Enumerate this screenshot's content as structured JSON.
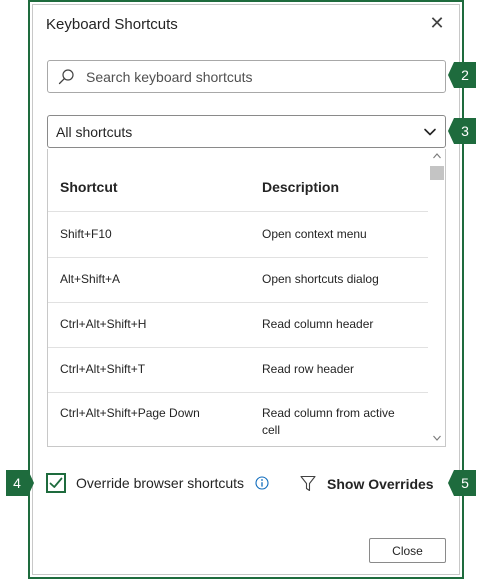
{
  "dialog": {
    "title": "Keyboard Shortcuts",
    "close_icon": "close-icon"
  },
  "search": {
    "placeholder": "Search keyboard shortcuts",
    "value": "",
    "icon": "search-icon"
  },
  "filter_dropdown": {
    "selected": "All shortcuts",
    "icon": "chevron-down-icon"
  },
  "table": {
    "headers": {
      "shortcut": "Shortcut",
      "description": "Description"
    },
    "rows": [
      {
        "shortcut": "Shift+F10",
        "description": "Open context menu"
      },
      {
        "shortcut": "Alt+Shift+A",
        "description": "Open shortcuts dialog"
      },
      {
        "shortcut": "Ctrl+Alt+Shift+H",
        "description": "Read column header"
      },
      {
        "shortcut": "Ctrl+Alt+Shift+T",
        "description": "Read row header"
      },
      {
        "shortcut": "Ctrl+Alt+Shift+Page Down",
        "description": "Read column from active cell"
      }
    ]
  },
  "override_checkbox": {
    "label": "Override browser shortcuts",
    "checked": true,
    "info_icon": "info-icon"
  },
  "show_overrides": {
    "label": "Show Overrides",
    "icon": "filter-icon"
  },
  "footer": {
    "close_label": "Close"
  },
  "callouts": [
    "2",
    "3",
    "4",
    "5"
  ],
  "colors": {
    "accent": "#1e6b3d",
    "info_blue": "#0f6cbd",
    "border": "#c8c8c8"
  }
}
